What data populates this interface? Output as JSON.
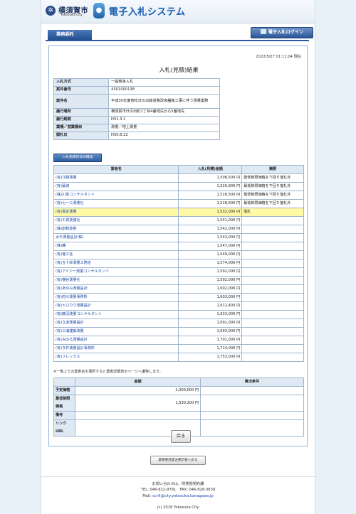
{
  "header": {
    "city_name": "横須賀市",
    "city_name_en": "Yokosuka City",
    "system_title": "電子入札システム"
  },
  "nav": {
    "tab_label": "業務委託",
    "login_button_label": "電子入札ログイン"
  },
  "panel": {
    "timestamp": "2022/5/27 01:11:04 現在",
    "title": "入札(見積)結果",
    "info": [
      {
        "label": "入札方式",
        "value": "一般競争入札"
      },
      {
        "label": "案件番号",
        "value": "4301000138"
      },
      {
        "label": "案件名",
        "value": "平成30年度若松日の出線道路改良舗装工事に伴う測量業務"
      },
      {
        "label": "履行場所",
        "value": "横須賀市日の出町1丁目4番地先から5番地先"
      },
      {
        "label": "履行期間",
        "value": "H31.3.1"
      },
      {
        "label": "業種／営業種目",
        "value": "測量／地上測量"
      },
      {
        "label": "開札日",
        "value": "H30.8.22"
      }
    ],
    "confirm_button_label": "入札指導記号の確認",
    "results": {
      "headers": {
        "name": "業者名",
        "amount": "入札(見積)金額",
        "remarks": "摘要"
      },
      "rows": [
        {
          "name": "(有)江藤測量",
          "amount": "1,508,500 円",
          "remarks": "最低制限価格を下回り落札外"
        },
        {
          "name": "(有)藝城",
          "amount": "1,520,900 円",
          "remarks": "最低制限価格を下回り落札外"
        },
        {
          "name": "(株)川坂コンサルタント",
          "amount": "1,528,500 円",
          "remarks": "最低制限価格を下回り落札外"
        },
        {
          "name": "(有)七一三測量社",
          "amount": "1,528,600 円",
          "remarks": "最低制限価格を下回り落札外"
        },
        {
          "name": "(有)喜友測量",
          "amount": "1,532,000 円",
          "remarks": "落札"
        },
        {
          "name": "(有)工測技建社",
          "amount": "1,541,000 円",
          "remarks": ""
        },
        {
          "name": "(株)創和技術",
          "amount": "1,542,000 円",
          "remarks": ""
        },
        {
          "name": "太平測量設計(株)",
          "amount": "1,543,000 円",
          "remarks": ""
        },
        {
          "name": "(株)曙",
          "amount": "1,547,000 円",
          "remarks": ""
        },
        {
          "name": "(有)瑠工社",
          "amount": "1,549,000 円",
          "remarks": ""
        },
        {
          "name": "(有)五十鈴測量工務店",
          "amount": "1,574,000 円",
          "remarks": ""
        },
        {
          "name": "(有)アイエー測量コンサルタンツ",
          "amount": "1,592,000 円",
          "remarks": ""
        },
        {
          "name": "(有)横谷測量社",
          "amount": "1,592,000 円",
          "remarks": ""
        },
        {
          "name": "(有)あゆみ測量設計",
          "amount": "1,602,000 円",
          "remarks": ""
        },
        {
          "name": "(有)府川測量事務所",
          "amount": "1,603,000 円",
          "remarks": ""
        },
        {
          "name": "(有)ヒロカワ測量設計",
          "amount": "1,612,400 円",
          "remarks": ""
        },
        {
          "name": "(有)藤沼測量コンサルタント",
          "amount": "1,633,000 円",
          "remarks": ""
        },
        {
          "name": "(有)立浪測量設計",
          "amount": "1,691,000 円",
          "remarks": ""
        },
        {
          "name": "(有)三浦建築測量",
          "amount": "1,693,000 円",
          "remarks": ""
        },
        {
          "name": "(有)みのる測量設計",
          "amount": "1,701,000 円",
          "remarks": ""
        },
        {
          "name": "(有)今井測量設計事務所",
          "amount": "1,714,000 円",
          "remarks": ""
        },
        {
          "name": "(有)フレックス",
          "amount": "1,753,000 円",
          "remarks": ""
        }
      ],
      "winning_index": 4
    },
    "note": "※一覧上での業者名を選択すると業者詳細表示ページへ遷移します。",
    "price_table": {
      "headers": {
        "amount": "金額",
        "condition": "算出条件"
      },
      "rows": [
        {
          "label": "予定価格",
          "amount": "2,000,000 円",
          "condition": ""
        },
        {
          "label": "最低制限価格",
          "amount": "1,530,200 円",
          "condition": ""
        },
        {
          "label": "備考",
          "amount": "",
          "condition": ""
        },
        {
          "label": "リンクURL",
          "amount": "",
          "condition": ""
        }
      ]
    },
    "back_button_label": "戻る"
  },
  "list_button_label": "業務委託発注掲示板へ戻る",
  "footer": {
    "line1": "お問い合わせは、財務部契約課",
    "line2": "TEL: 046-822-9791　FAX: 046-828-3839",
    "mail_prefix": "Mail: ",
    "mail": "co-fi@city.yokosuka.kanagawa.jp",
    "copyright": "(c) 2018 Yokosuka City"
  },
  "colors": {
    "accent": "#2c5aa0",
    "winner_highlight": "#fff9a6",
    "link": "#1846a6"
  }
}
